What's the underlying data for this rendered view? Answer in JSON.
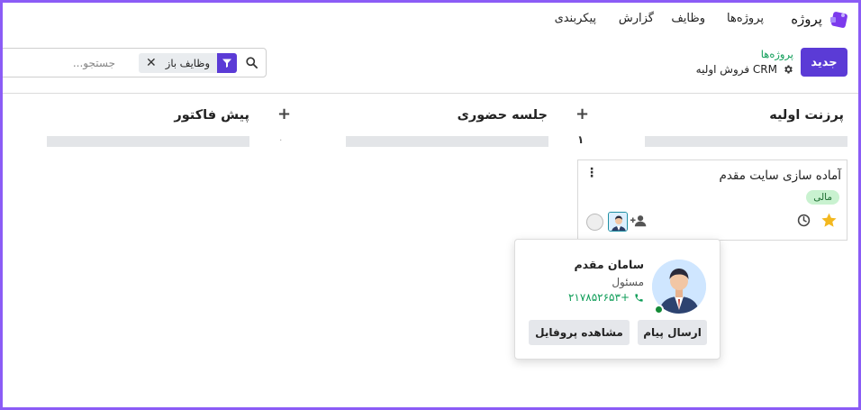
{
  "nav": {
    "app_title": "پروژه",
    "items": [
      "پروژه‌ها",
      "وظایف",
      "گزارش",
      "پیکربندی"
    ]
  },
  "control": {
    "new_label": "جدید",
    "breadcrumb_parent": "پروژه‌ها",
    "breadcrumb_current": "فروش اولیه CRM",
    "facet_label": "وظایف باز",
    "search_placeholder": "جستجو..."
  },
  "columns": [
    {
      "title": "پرزنت اولیه",
      "count": "۱"
    },
    {
      "title": "جلسه حضوری",
      "count": "۰"
    },
    {
      "title": "پیش فاکتور",
      "count": ""
    }
  ],
  "card": {
    "title": "آماده سازی سایت مقدم",
    "tag": "مالی",
    "starred": true
  },
  "popover": {
    "name": "سامان مقدم",
    "role": "مسئول",
    "phone": "۲۱۷۸۵۲۶۵۳+",
    "send_message": "ارسال پیام",
    "view_profile": "مشاهده پروفایل"
  },
  "colors": {
    "accent": "#5b3bd6",
    "frame": "#8b5cf6",
    "link_green": "#0f9d58",
    "tag_bg": "#c9f2d0",
    "star": "#f3b81f"
  }
}
